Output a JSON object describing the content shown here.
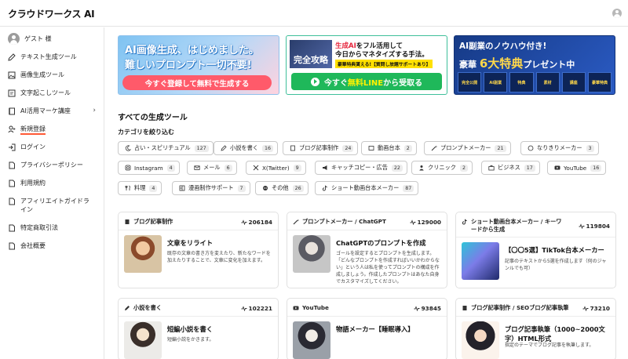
{
  "brand": {
    "name": "クラウドワークス AI"
  },
  "sidebar": {
    "guest": "ゲスト 様",
    "items": [
      {
        "label": "テキスト生成ツール"
      },
      {
        "label": "画像生成ツール"
      },
      {
        "label": "文字起こしツール"
      },
      {
        "label": "AI活用マーケ講座"
      },
      {
        "label": "新規登録"
      },
      {
        "label": "ログイン"
      },
      {
        "label": "プライバシーポリシー"
      },
      {
        "label": "利用規約"
      },
      {
        "label": "アフィリエイトガイドライン"
      },
      {
        "label": "特定商取引法"
      },
      {
        "label": "会社概要"
      }
    ]
  },
  "banners": {
    "b1": {
      "line1": "AI画像生成、はじめました。",
      "line2": "難しいプロンプト一切不要!",
      "cta": "今すぐ登録して無料で生成する"
    },
    "b2": {
      "book": "完全攻略",
      "line1_red": "生成AI",
      "line1_rest": "をフル活用して",
      "line2": "今日からマネタイズする手法。",
      "line3": "豪華特典貰える!【質問し放題サポートあり】",
      "cta_pre": "今すぐ",
      "cta_hl": "無料LINE",
      "cta_post": "から受取る"
    },
    "b3": {
      "line1": "AI副業のノウハウ付き!",
      "line2_pre": "豪華",
      "line2_gold": "6大特典",
      "line2_post": "プレゼント中",
      "gifts": [
        "完全公開",
        "AI副業",
        "特典",
        "素材",
        "講座",
        "豪華特典"
      ]
    }
  },
  "main": {
    "section_title": "すべての生成ツール",
    "category_label": "カテゴリを絞り込む"
  },
  "chips": [
    {
      "label": "占い・スピリチュアル",
      "count": "127",
      "icon": "moon-icon"
    },
    {
      "label": "小説を書く",
      "count": "16",
      "icon": "pen-icon"
    },
    {
      "label": "ブログ記事制作",
      "count": "24",
      "icon": "book-icon"
    },
    {
      "label": "動画台本",
      "count": "2",
      "icon": "film-icon"
    },
    {
      "label": "プロンプトメーカー",
      "count": "21",
      "icon": "wand-icon"
    },
    {
      "label": "なりきりメーカー",
      "count": "3",
      "icon": "face-icon"
    },
    {
      "label": "Instagram",
      "count": "4",
      "icon": "instagram-icon"
    },
    {
      "label": "メール",
      "count": "6",
      "icon": "mail-icon"
    },
    {
      "label": "X(Twitter)",
      "count": "9",
      "icon": "x-icon"
    },
    {
      "label": "キャッチコピー・広告",
      "count": "22",
      "icon": "megaphone-icon"
    },
    {
      "label": "クリニック",
      "count": "2",
      "icon": "doctor-icon"
    },
    {
      "label": "ビジネス",
      "count": "17",
      "icon": "briefcase-icon"
    },
    {
      "label": "YouTube",
      "count": "16",
      "icon": "youtube-icon"
    },
    {
      "label": "料理",
      "count": "4",
      "icon": "cutlery-icon"
    },
    {
      "label": "漫画制作サポート",
      "count": "7",
      "icon": "comic-icon"
    },
    {
      "label": "その他",
      "count": "26",
      "icon": "misc-icon"
    },
    {
      "label": "ショート動画台本メーカー",
      "count": "87",
      "icon": "tiktok-icon"
    }
  ],
  "cards": [
    {
      "category": "ブログ記事制作",
      "stat": "206184",
      "title": "文章をリライト",
      "desc": "既存の文章の書き方を変えたり、新たなワードを加えたりすることで、文章に変化を加えます。",
      "icon": "book-icon"
    },
    {
      "category": "プロンプトメーカー / ChatGPT",
      "stat": "129000",
      "title": "ChatGPTのプロンプトを作成",
      "desc": "ゴールを設定するとプロンプトを生成します。「どんなプロンプトを作成すればいいかわからない」という人は私を使ってプロンプトの構成を作成しましょう。作成したプロンプトはあなた自身でカスタマイズしてください。",
      "icon": "wand-icon"
    },
    {
      "category": "ショート動画台本メーカー / キーワードから生成",
      "stat": "119804",
      "title": "【〇〇5選】TikTok台本メーカー",
      "desc": "記事のテキストから5選を作成します（何のジャンルでも可）",
      "icon": "tiktok-icon"
    },
    {
      "category": "小説を書く",
      "stat": "102221",
      "title": "短編小説を書く",
      "desc": "短編小説をかきます。",
      "icon": "pen-icon"
    },
    {
      "category": "YouTube",
      "stat": "93845",
      "title": "物語メーカー【睡眠導入】",
      "desc": "",
      "icon": "youtube-icon"
    },
    {
      "category": "ブログ記事制作 / SEOブログ記事執筆",
      "stat": "73210",
      "title": "ブログ記事執筆（1000~2000文字）HTML形式",
      "desc": "指定のテーマでブログ記事を執筆します。",
      "icon": "book-icon"
    }
  ],
  "colors": {
    "accent": "#ff5a36",
    "brand": "#5b2bd8",
    "line_green": "#1fb85a"
  }
}
